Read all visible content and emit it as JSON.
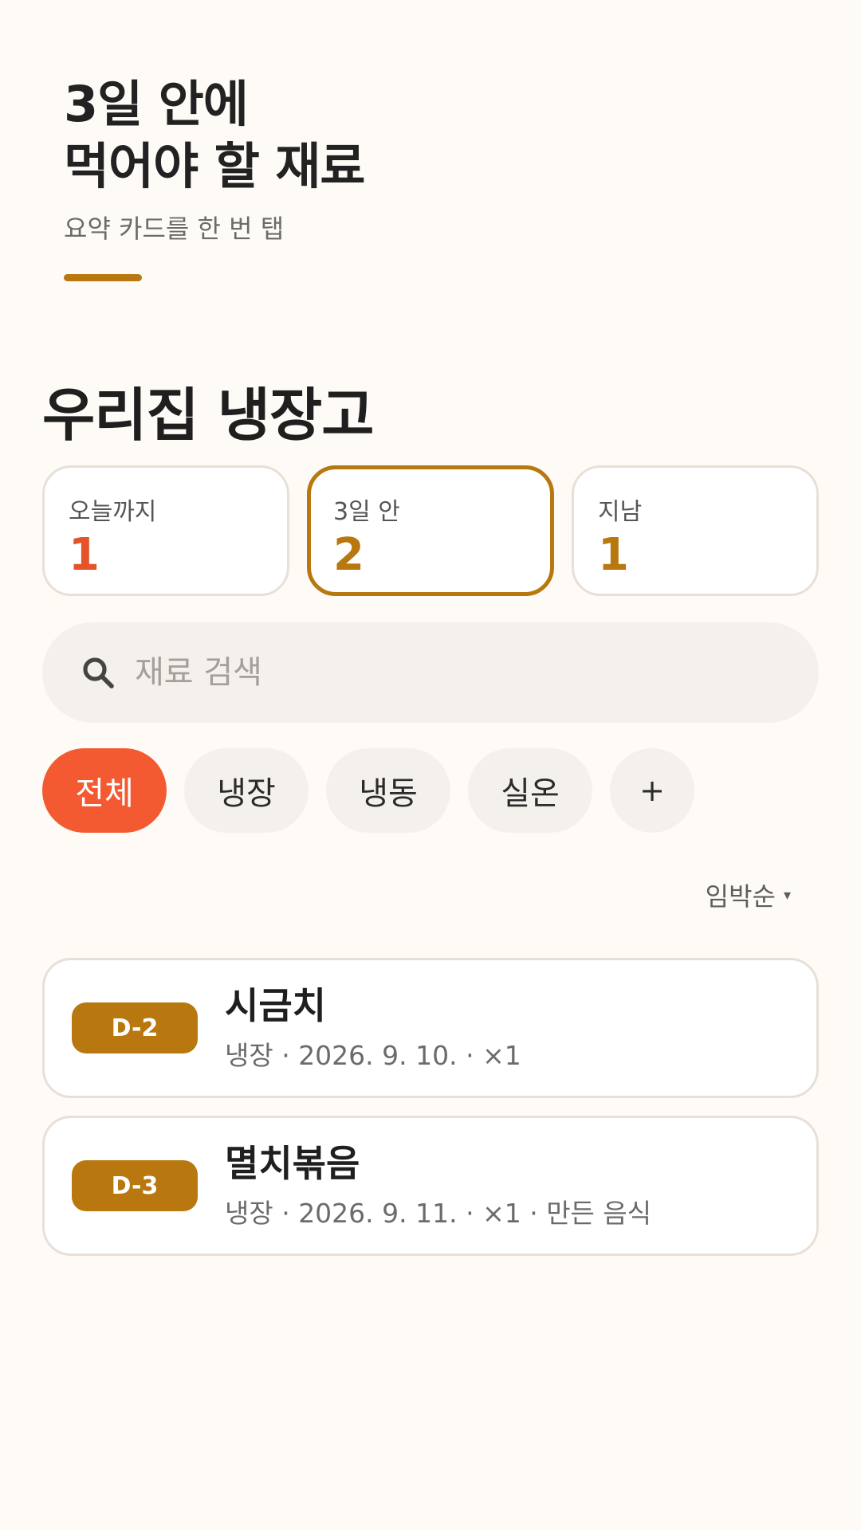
{
  "hint": {
    "title_line1": "3일 안에",
    "title_line2": "먹어야 할 재료",
    "subtitle": "요약 카드를 한 번 탭"
  },
  "page_title": "우리집 냉장고",
  "summary_cards": [
    {
      "label": "오늘까지",
      "count": "1",
      "color": "#E5532B",
      "active": false
    },
    {
      "label": "3일 안",
      "count": "2",
      "color": "#B8770F",
      "active": true
    },
    {
      "label": "지남",
      "count": "1",
      "color": "#B8770F",
      "active": false
    }
  ],
  "search": {
    "placeholder": "재료 검색",
    "icon": "search-icon"
  },
  "filters": {
    "chips": [
      "전체",
      "냉장",
      "냉동",
      "실온"
    ],
    "active": "전체",
    "add_label": "+"
  },
  "sort": {
    "label": "임박순",
    "caret": "▾"
  },
  "items": [
    {
      "badge": "D-2",
      "name": "시금치",
      "meta": "냉장 · 2026. 9. 10. · ×1"
    },
    {
      "badge": "D-3",
      "name": "멸치볶음",
      "meta": "냉장 · 2026. 9. 11. · ×1 · 만든 음식"
    }
  ],
  "colors": {
    "accent": "#B8770F",
    "chip_active": "#F45A32",
    "background": "#FEFBF6"
  }
}
